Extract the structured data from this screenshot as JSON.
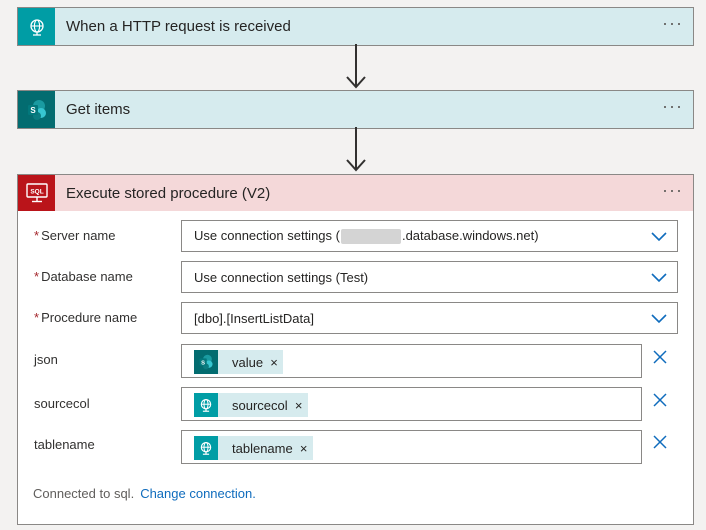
{
  "flow": {
    "steps": [
      {
        "title": "When a HTTP request is received",
        "icon": "globe-request-icon",
        "color": "#009da5"
      },
      {
        "title": "Get items",
        "icon": "sharepoint-icon",
        "color": "#036c70"
      },
      {
        "title": "Execute stored procedure (V2)",
        "icon": "sql-icon",
        "color": "#ba141a"
      }
    ],
    "menu_glyph": "···"
  },
  "sql": {
    "fields": {
      "server": {
        "label": "Server name",
        "required": true,
        "value_prefix": "Use connection settings (",
        "value_suffix": ".database.windows.net)"
      },
      "database": {
        "label": "Database name",
        "required": true,
        "value": "Use connection settings (Test)"
      },
      "procedure": {
        "label": "Procedure name",
        "required": true,
        "value": "[dbo].[InsertListData]"
      },
      "json": {
        "label": "json",
        "token": "value",
        "token_icon": "sharepoint-icon"
      },
      "sourcecol": {
        "label": "sourcecol",
        "token": "sourcecol",
        "token_icon": "globe-request-icon"
      },
      "tablename": {
        "label": "tablename",
        "token": "tablename",
        "token_icon": "globe-request-icon"
      }
    },
    "required_mark": "*",
    "token_remove": "×",
    "footer": {
      "text": "Connected to sql.",
      "link": "Change connection."
    }
  }
}
